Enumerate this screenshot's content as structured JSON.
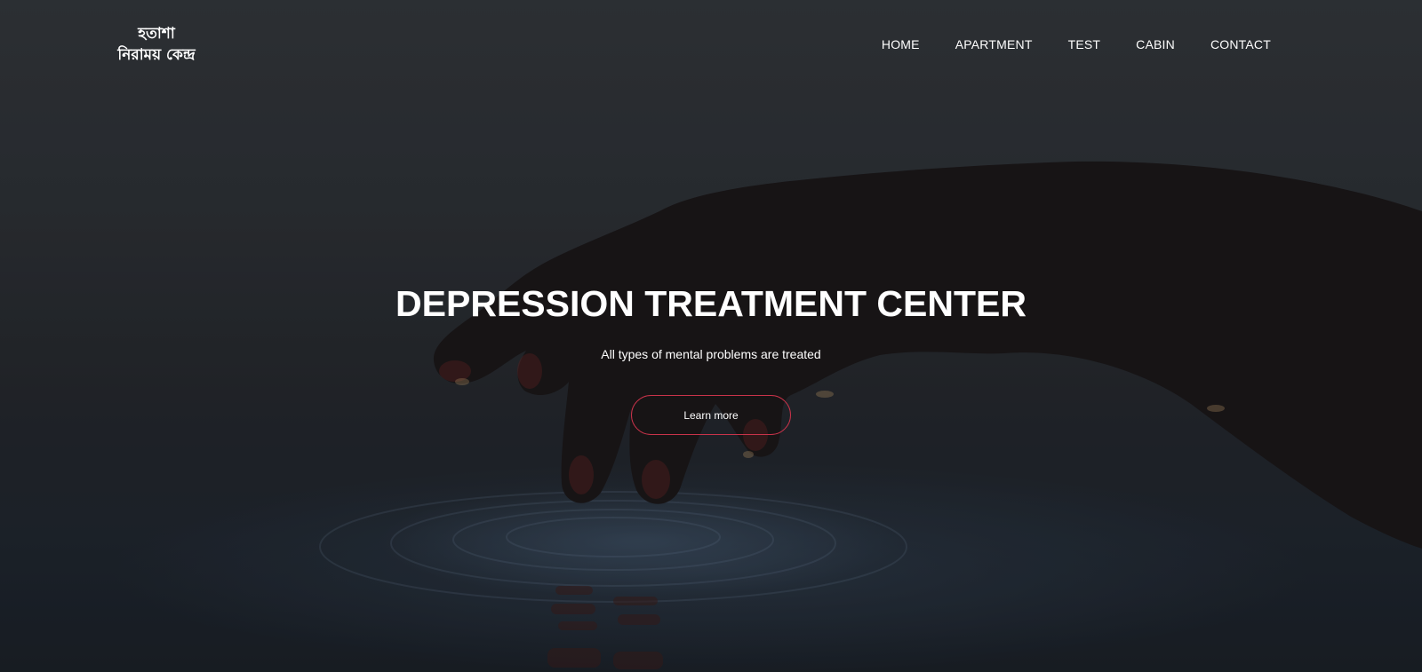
{
  "logo": {
    "line1": "হতাশা",
    "line2": "নিরাময় কেন্দ্র"
  },
  "nav": {
    "items": [
      {
        "label": "HOME"
      },
      {
        "label": "APARTMENT"
      },
      {
        "label": "TEST"
      },
      {
        "label": "CABIN"
      },
      {
        "label": "CONTACT"
      }
    ]
  },
  "hero": {
    "title": "DEPRESSION TREATMENT CENTER",
    "subtitle": "All types of mental problems are treated",
    "button_label": "Learn more",
    "background_image": "hand-touching-water-photo"
  },
  "colors": {
    "text": "#ffffff",
    "button_border": "#c9334a",
    "background_dark": "#1e2226"
  }
}
